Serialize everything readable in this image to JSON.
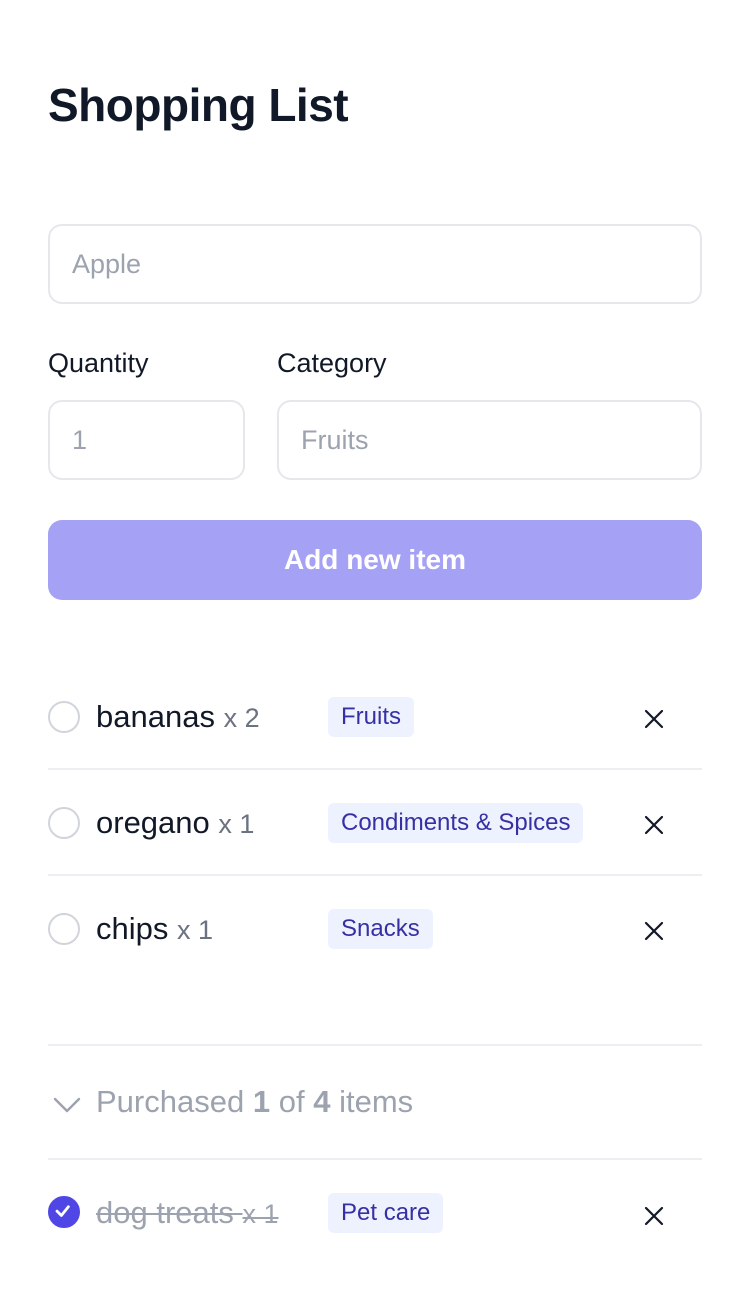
{
  "title": "Shopping List",
  "form": {
    "name_placeholder": "Apple",
    "quantity_label": "Quantity",
    "quantity_placeholder": "1",
    "category_label": "Category",
    "category_placeholder": "Fruits",
    "add_button_label": "Add new item"
  },
  "colors": {
    "accent": "#4f46e5",
    "button_disabled": "#a5a1f4",
    "badge_bg": "#eef2ff",
    "badge_text": "#3730a3"
  },
  "items": [
    {
      "name": "bananas",
      "qty": "x 2",
      "category": "Fruits",
      "checked": false
    },
    {
      "name": "oregano",
      "qty": "x 1",
      "category": "Condiments & Spices",
      "checked": false
    },
    {
      "name": "chips",
      "qty": "x 1",
      "category": "Snacks",
      "checked": false
    }
  ],
  "purchased": {
    "prefix": "Purchased",
    "count": "1",
    "of": "of",
    "total": "4",
    "suffix": "items",
    "icon": "chevron-down-icon",
    "items": [
      {
        "name": "dog treats",
        "qty": "x 1",
        "category": "Pet care",
        "checked": true
      }
    ]
  }
}
